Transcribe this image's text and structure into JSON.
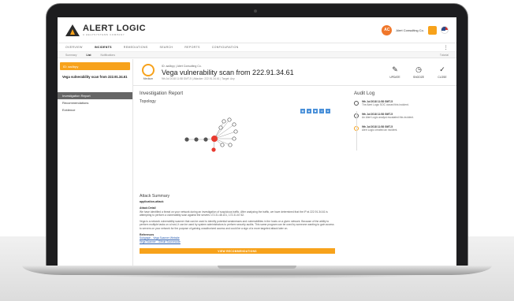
{
  "app": {
    "logo_main": "ALERT LOGIC",
    "logo_tagline": "A HELPSYSTEMS COMPANY",
    "account_initials": "AC",
    "account_name": "Alert Consulting Co."
  },
  "main_nav": [
    "OVERVIEW",
    "INCIDENTS",
    "REMEDIATIONS",
    "SEARCH",
    "REPORTS",
    "CONFIGURATION"
  ],
  "main_nav_active": "INCIDENTS",
  "sub_nav": [
    "Summary",
    "List",
    "Notifications"
  ],
  "sub_nav_active": "List",
  "sub_nav_right": "Tutorial",
  "sidebar": {
    "severity_chip": "ID: aa4bpy",
    "title": "Vega vulnerability scan from 222.91.34.61",
    "menu": [
      "Investigation Report",
      "Recommendations",
      "Evidence"
    ],
    "menu_active": "Investigation Report"
  },
  "incident": {
    "severity": "Medium",
    "meta": "ID: aa4bpy | Alert Consulting Co.",
    "title": "Vega vulnerability scan from 222.91.34.61",
    "subtitle": "9th Jul 2018 11:58 GMT-5 | Attacker: 222.91.34.61 | Target: Any",
    "actions": [
      {
        "icon": "pencil-icon",
        "glyph": "✎",
        "label": "UPDATE"
      },
      {
        "icon": "clock-icon",
        "glyph": "◷",
        "label": "SNOOZE"
      },
      {
        "icon": "check-icon",
        "glyph": "✓",
        "label": "CLOSE"
      }
    ]
  },
  "report": {
    "heading": "Investigation Report",
    "topology_heading": "Topology",
    "attack_summary_heading": "Attack Summary",
    "attack_class": "application-attack",
    "attack_detail_label": "Attack Detail",
    "attack_detail_text": "We have identified a threat on your network during an investigation of suspicious traffic. After analyzing the traffic, we have determined that the IP at 222.91.34.61 is attempting to perform a vulnerability scan against the servers 172.31.48.101, 172.31.67.52.",
    "attack_detail_text_2": "Vega is a network vulnerability scanner that can be used to identify potential weaknesses and vulnerabilities in the hosts on a given network. Because of the ability to perform multiple tasks on a host, it can be used by system administrators to perform security audits. This same program can be used by someone wanting to gain access to servers on your network for the purpose of gaining unauthorized access and could be a sign of a more targeted attack later on.",
    "references_label": "References",
    "references": [
      "Subgraph - Vega Scanner Website",
      "Vega Scanner - Github Sourcecode"
    ],
    "recommend_button": "VIEW RECOMMENDATIONS"
  },
  "audit_log": {
    "heading": "Audit Log",
    "entries": [
      {
        "time": "9th Jul 2018 11:58 GMT-5",
        "message": "The Alert Logic SOC closed this incident.",
        "kind": "closed"
      },
      {
        "time": "9th Jul 2018 11:58 GMT-5",
        "message": "An Alert Logic analyst escalated this incident.",
        "kind": "escalated"
      },
      {
        "time": "9th Jul 2018 11:58 GMT-5",
        "message": "Alert Logic created an incident.",
        "kind": "alert"
      }
    ]
  },
  "colors": {
    "accent": "#f7a21b",
    "brand_red": "#e8502a",
    "link": "#2a5db0",
    "attacker_node": "#e83a2f"
  }
}
